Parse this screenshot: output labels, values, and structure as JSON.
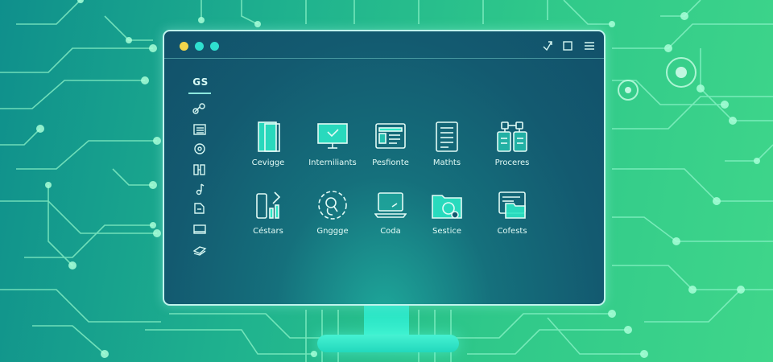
{
  "window": {
    "logo": "GS",
    "title_dots": [
      "yellow",
      "cyan",
      "cyan"
    ],
    "controls": [
      "restore-icon",
      "maximize-icon",
      "menu-icon"
    ]
  },
  "sidebar": {
    "items": [
      "link-icon",
      "list-icon",
      "dial-icon",
      "grid-icon",
      "music-icon",
      "document-icon",
      "window-icon",
      "layers-icon"
    ]
  },
  "apps": {
    "row1": [
      {
        "label": "Cevigge",
        "icon": "files-icon"
      },
      {
        "label": "Interniliants",
        "icon": "monitor-icon"
      },
      {
        "label": "Pesfionte",
        "icon": "dashboard-icon"
      },
      {
        "label": "Mathts",
        "icon": "document-list-icon"
      },
      {
        "label": "Proceres",
        "icon": "network-icon"
      }
    ],
    "row2": [
      {
        "label": "Céstars",
        "icon": "tools-icon"
      },
      {
        "label": "Gnggge",
        "icon": "magnifier-circle-icon"
      },
      {
        "label": "Coda",
        "icon": "laptop-icon"
      },
      {
        "label": "Sestice",
        "icon": "folder-search-icon"
      },
      {
        "label": "Cofests",
        "icon": "folder-card-icon"
      }
    ]
  },
  "colors": {
    "background_start": "#0f8f8c",
    "background_end": "#3fd68a",
    "circuit": "#8ef5c9",
    "window_bg": "#135a70",
    "accent": "#2fe0cf",
    "dot_yellow": "#f2d64a"
  }
}
